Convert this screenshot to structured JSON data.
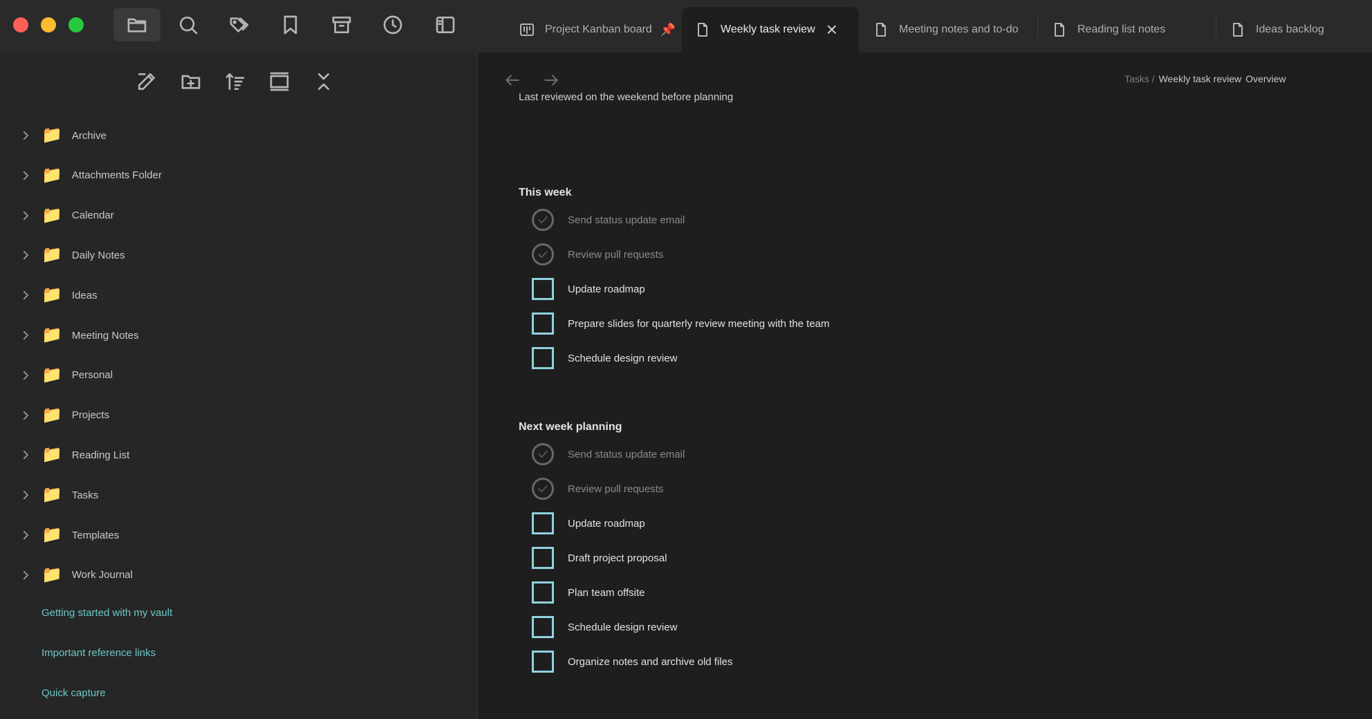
{
  "window": {
    "active_ribbon": "files-icon",
    "accent": "#6cc7c7"
  },
  "tabs": [
    {
      "label": "Project Kanban board",
      "icon": "kanban-icon",
      "pinned": true,
      "active": false
    },
    {
      "label": "Weekly task review",
      "icon": "file-icon",
      "active": true,
      "close": "×"
    },
    {
      "label": "Meeting notes and to-do",
      "icon": "file-icon",
      "active": false
    },
    {
      "label": "Reading list notes",
      "icon": "file-icon",
      "active": false
    },
    {
      "label": "Ideas backlog",
      "icon": "file-icon",
      "active": false
    }
  ],
  "sidebar": {
    "folders": [
      {
        "name": "Archive",
        "icon": "📁"
      },
      {
        "name": "Attachments Folder",
        "icon": "📁"
      },
      {
        "name": "Calendar",
        "icon": "📁"
      },
      {
        "name": "Daily Notes",
        "icon": "📁"
      },
      {
        "name": "Ideas",
        "icon": "📁"
      },
      {
        "name": "Meeting Notes",
        "icon": "📁"
      },
      {
        "name": "Personal",
        "icon": "📁"
      },
      {
        "name": "Projects",
        "icon": "📁"
      },
      {
        "name": "Reading List",
        "icon": "📁"
      },
      {
        "name": "Tasks",
        "icon": "📁"
      },
      {
        "name": "Templates",
        "icon": "📁"
      },
      {
        "name": "Work Journal",
        "icon": "📁"
      }
    ],
    "files": [
      {
        "name": "Getting started with my vault"
      },
      {
        "name": "Important reference links"
      },
      {
        "name": "Quick capture"
      }
    ]
  },
  "editor": {
    "breadcrumb": {
      "prefix": "Tasks /",
      "current": "Weekly task review",
      "next": "Overview"
    },
    "prev_line": "Last reviewed on the weekend before planning",
    "sections": [
      {
        "heading": "This week",
        "tasks": [
          {
            "text": "Send status update email",
            "done": true
          },
          {
            "text": "Review pull requests",
            "done": true
          },
          {
            "text": "Update roadmap",
            "done": false
          },
          {
            "text": "Prepare slides for quarterly review meeting with the team",
            "done": false
          },
          {
            "text": "Schedule design review",
            "done": false
          }
        ]
      },
      {
        "heading": "Next week planning",
        "tasks": [
          {
            "text": "Send status update email",
            "done": true
          },
          {
            "text": "Review pull requests",
            "done": true
          },
          {
            "text": "Update roadmap",
            "done": false
          },
          {
            "text": "Draft project proposal",
            "done": false
          },
          {
            "text": "Plan team offsite",
            "done": false
          },
          {
            "text": "Schedule design review",
            "done": false
          },
          {
            "text": "Organize notes and archive old files",
            "done": false
          }
        ]
      }
    ]
  }
}
